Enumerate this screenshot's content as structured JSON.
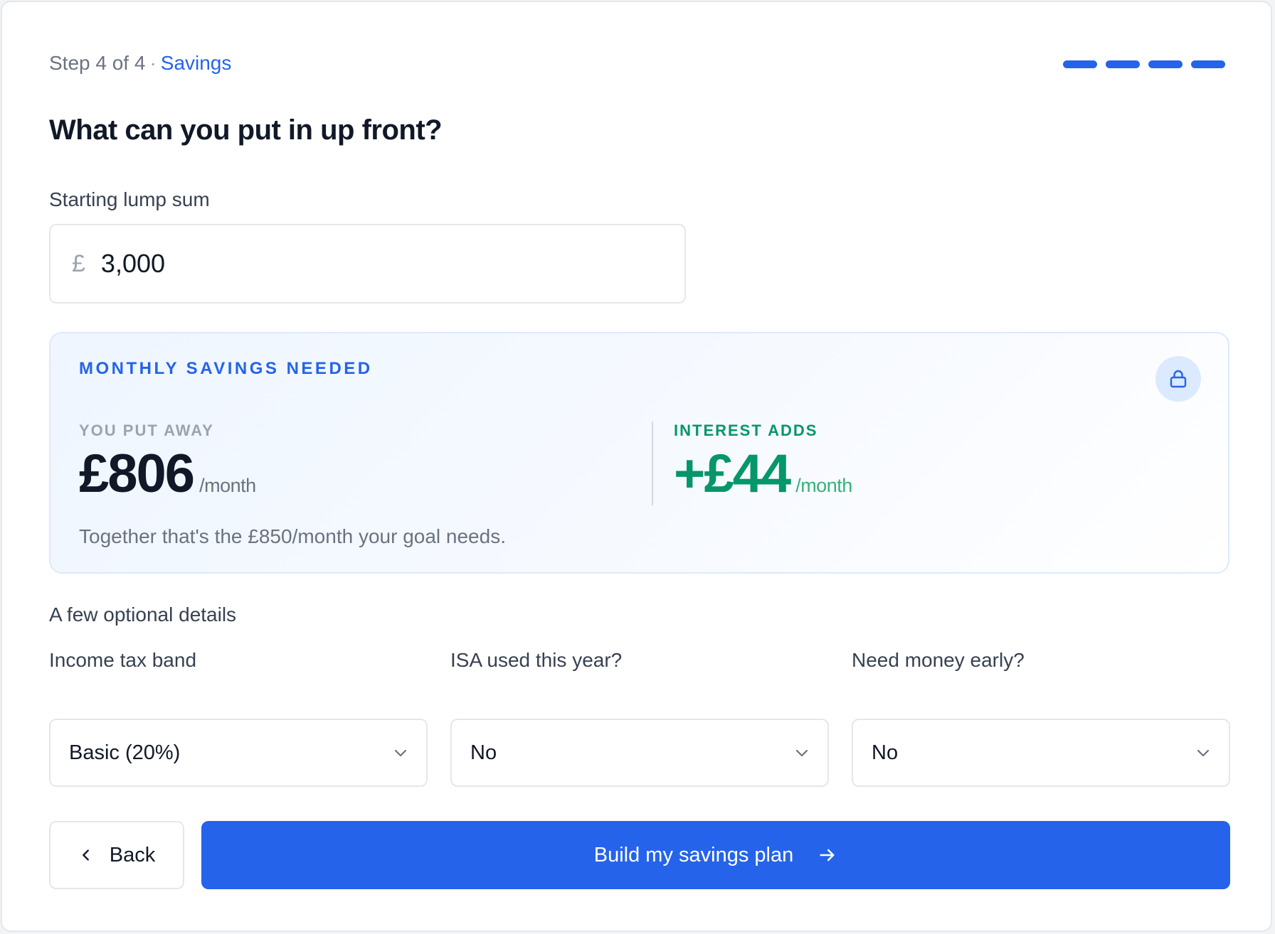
{
  "header": {
    "step_text": "Step 4 of 4",
    "separator": "·",
    "step_name": "Savings",
    "progress_segments": 4,
    "progress_completed": 4,
    "accent_color": "#2563eb"
  },
  "question": {
    "title": "What can you put in up front?"
  },
  "lump_sum": {
    "label": "Starting lump sum",
    "currency_symbol": "£",
    "value": "3,000"
  },
  "monthly_panel": {
    "heading": "MONTHLY SAVINGS NEEDED",
    "lock_icon": "lock-icon",
    "you_put_away": {
      "label": "YOU PUT AWAY",
      "amount": "£806",
      "unit": "/month"
    },
    "interest_adds": {
      "label": "INTEREST ADDS",
      "amount": "+£44",
      "unit": "/month",
      "color": "#059669"
    },
    "note": "Together that's the £850/month your goal needs."
  },
  "optional": {
    "heading": "A few optional details",
    "fields": [
      {
        "label": "Income tax band",
        "value": "Basic (20%)"
      },
      {
        "label": "ISA used this year?",
        "value": "No"
      },
      {
        "label": "Need money early?",
        "value": "No"
      }
    ]
  },
  "actions": {
    "back_label": "Back",
    "primary_label": "Build my savings plan"
  }
}
